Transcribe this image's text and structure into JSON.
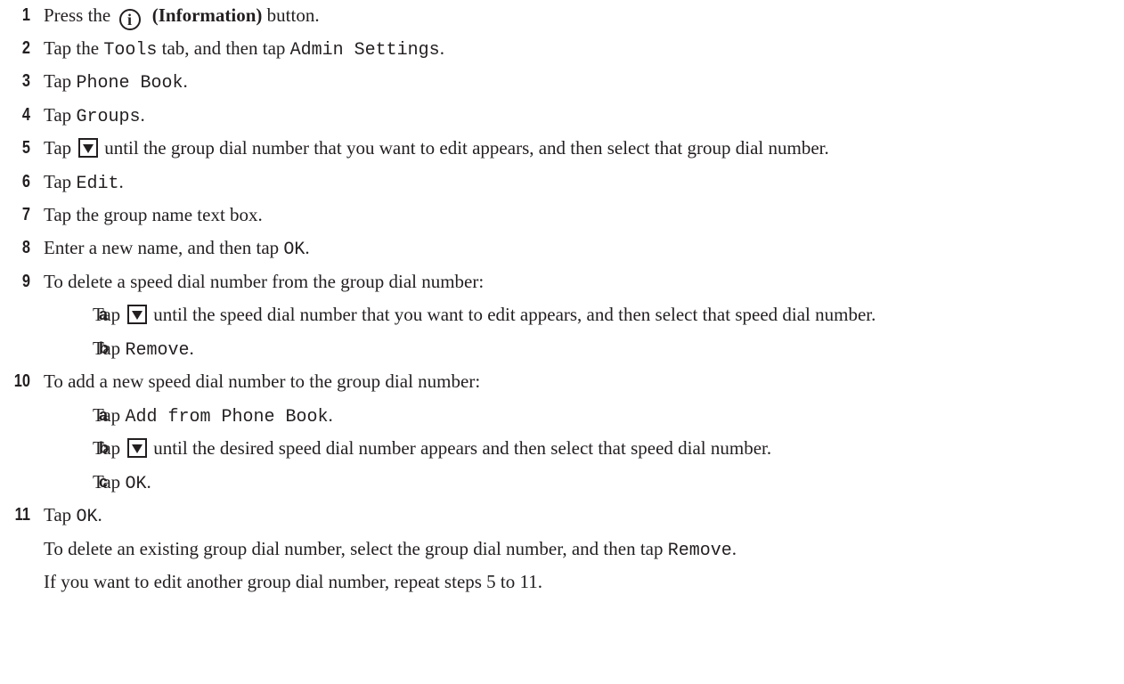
{
  "steps": [
    {
      "num": "1",
      "a": "Press the",
      "b": "(Information)",
      "c": "button."
    },
    {
      "num": "2",
      "a": "Tap the",
      "b": "Tools",
      "c": "tab, and then tap",
      "d": "Admin Settings",
      "e": "."
    },
    {
      "num": "3",
      "a": "Tap",
      "b": "Phone Book",
      "c": "."
    },
    {
      "num": "4",
      "a": "Tap",
      "b": "Groups",
      "c": "."
    },
    {
      "num": "5",
      "a": "Tap",
      "b": "until the group dial number that you want to edit appears, and then select that group dial number."
    },
    {
      "num": "6",
      "a": "Tap",
      "b": "Edit",
      "c": "."
    },
    {
      "num": "7",
      "a": "Tap the group name text box."
    },
    {
      "num": "8",
      "a": "Enter a new name, and then tap",
      "b": "OK",
      "c": "."
    },
    {
      "num": "9",
      "a": "To delete a speed dial number from the group dial number:"
    },
    {
      "num": "10",
      "a": "To add a new speed dial number to the group dial number:"
    },
    {
      "num": "11",
      "a": "Tap",
      "b": "OK",
      "c": "."
    }
  ],
  "substeps_9": [
    {
      "num": "a",
      "a": "Tap",
      "b": "until the speed dial number that you want to edit appears, and then select that speed dial number."
    },
    {
      "num": "b",
      "a": "Tap",
      "b": "Remove",
      "c": "."
    }
  ],
  "substeps_10": [
    {
      "num": "a",
      "a": "Tap",
      "b": "Add from Phone Book",
      "c": "."
    },
    {
      "num": "b",
      "a": "Tap",
      "b": "until the desired speed dial number appears and then select that speed dial number."
    },
    {
      "num": "c",
      "a": "Tap",
      "b": "OK",
      "c": "."
    }
  ],
  "notes": {
    "delete_a": "To delete an existing group dial number, select the group dial number, and then tap",
    "delete_b": "Remove",
    "delete_c": ".",
    "repeat": "If you want to edit another group dial number, repeat steps 5 to 11."
  },
  "icons": {
    "info": "i"
  }
}
